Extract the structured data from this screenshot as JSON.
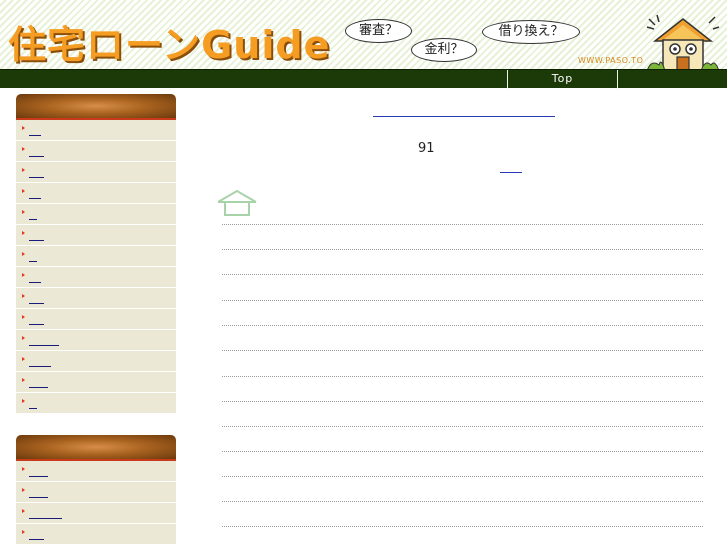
{
  "header": {
    "logo_text": "住宅ローンGuide",
    "bubbles": [
      "審査？",
      "金利？",
      "借り換え？"
    ],
    "site_url": "WWW.PASO.TO"
  },
  "nav": {
    "top_label": "Top"
  },
  "main": {
    "count_text": "91"
  },
  "colors": {
    "logo_orange": "#f59c23",
    "nav_green": "#1c3a07",
    "sidebar_brown": "#a9621f",
    "menu_bg": "#ebe8d6",
    "bullet_red": "#e23a1a",
    "link_blue": "#2a3ab5",
    "house_icon_green": "#a8d3a8"
  }
}
